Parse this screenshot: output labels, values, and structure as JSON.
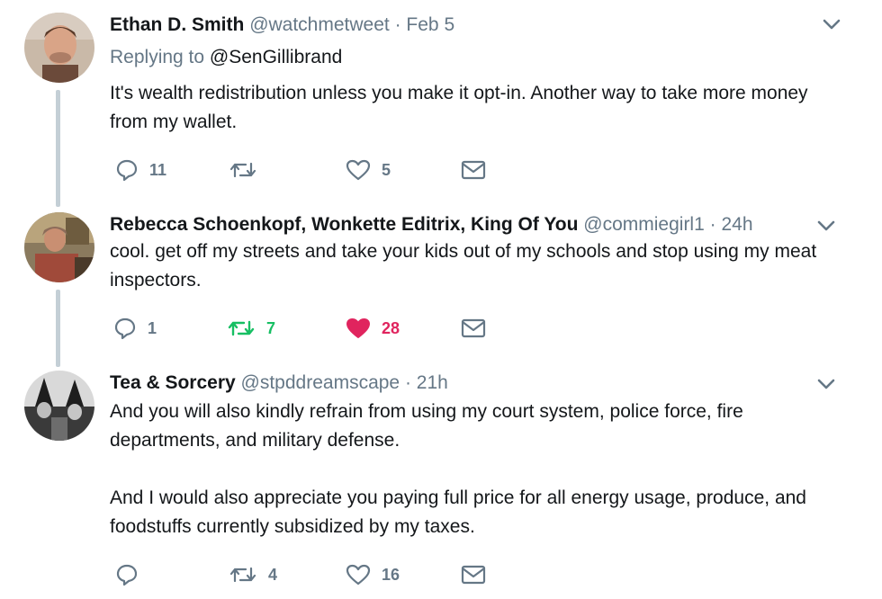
{
  "tweets": [
    {
      "name": "Ethan D. Smith",
      "handle": "@watchmetweet",
      "separator": "·",
      "time": "Feb 5",
      "replying_label": "Replying to",
      "replying_to": "@SenGillibrand",
      "text": "It's wealth redistribution unless you make it opt-in. Another way to take more money from my wallet.",
      "reply_count": "11",
      "retweet_count": "",
      "like_count": "5",
      "retweeted": false,
      "liked": false,
      "avatar_icon": "user-avatar-icon"
    },
    {
      "name": "Rebecca Schoenkopf, Wonkette Editrix, King Of You",
      "handle": "@commiegirl1",
      "separator": "·",
      "time": "24h",
      "text": "cool. get off my streets and take your kids out of my schools and stop using my meat inspectors.",
      "reply_count": "1",
      "retweet_count": "7",
      "like_count": "28",
      "retweeted": true,
      "liked": true,
      "avatar_icon": "user-avatar-icon"
    },
    {
      "name": "Tea & Sorcery",
      "handle": "@stpddreamscape",
      "separator": "·",
      "time": "21h",
      "text": "And you will also kindly refrain from using my court system, police force, fire departments, and military defense.\n\nAnd I would also appreciate you paying full price for all energy usage, produce, and foodstuffs currently subsidized by my taxes.",
      "reply_count": "",
      "retweet_count": "4",
      "like_count": "16",
      "retweeted": false,
      "liked": false,
      "avatar_icon": "user-avatar-icon"
    }
  ],
  "colors": {
    "text": "#14171a",
    "secondary": "#657786",
    "retweet_active": "#17bf63",
    "like_active": "#e0245e",
    "thread_line": "#c4cfd6"
  }
}
